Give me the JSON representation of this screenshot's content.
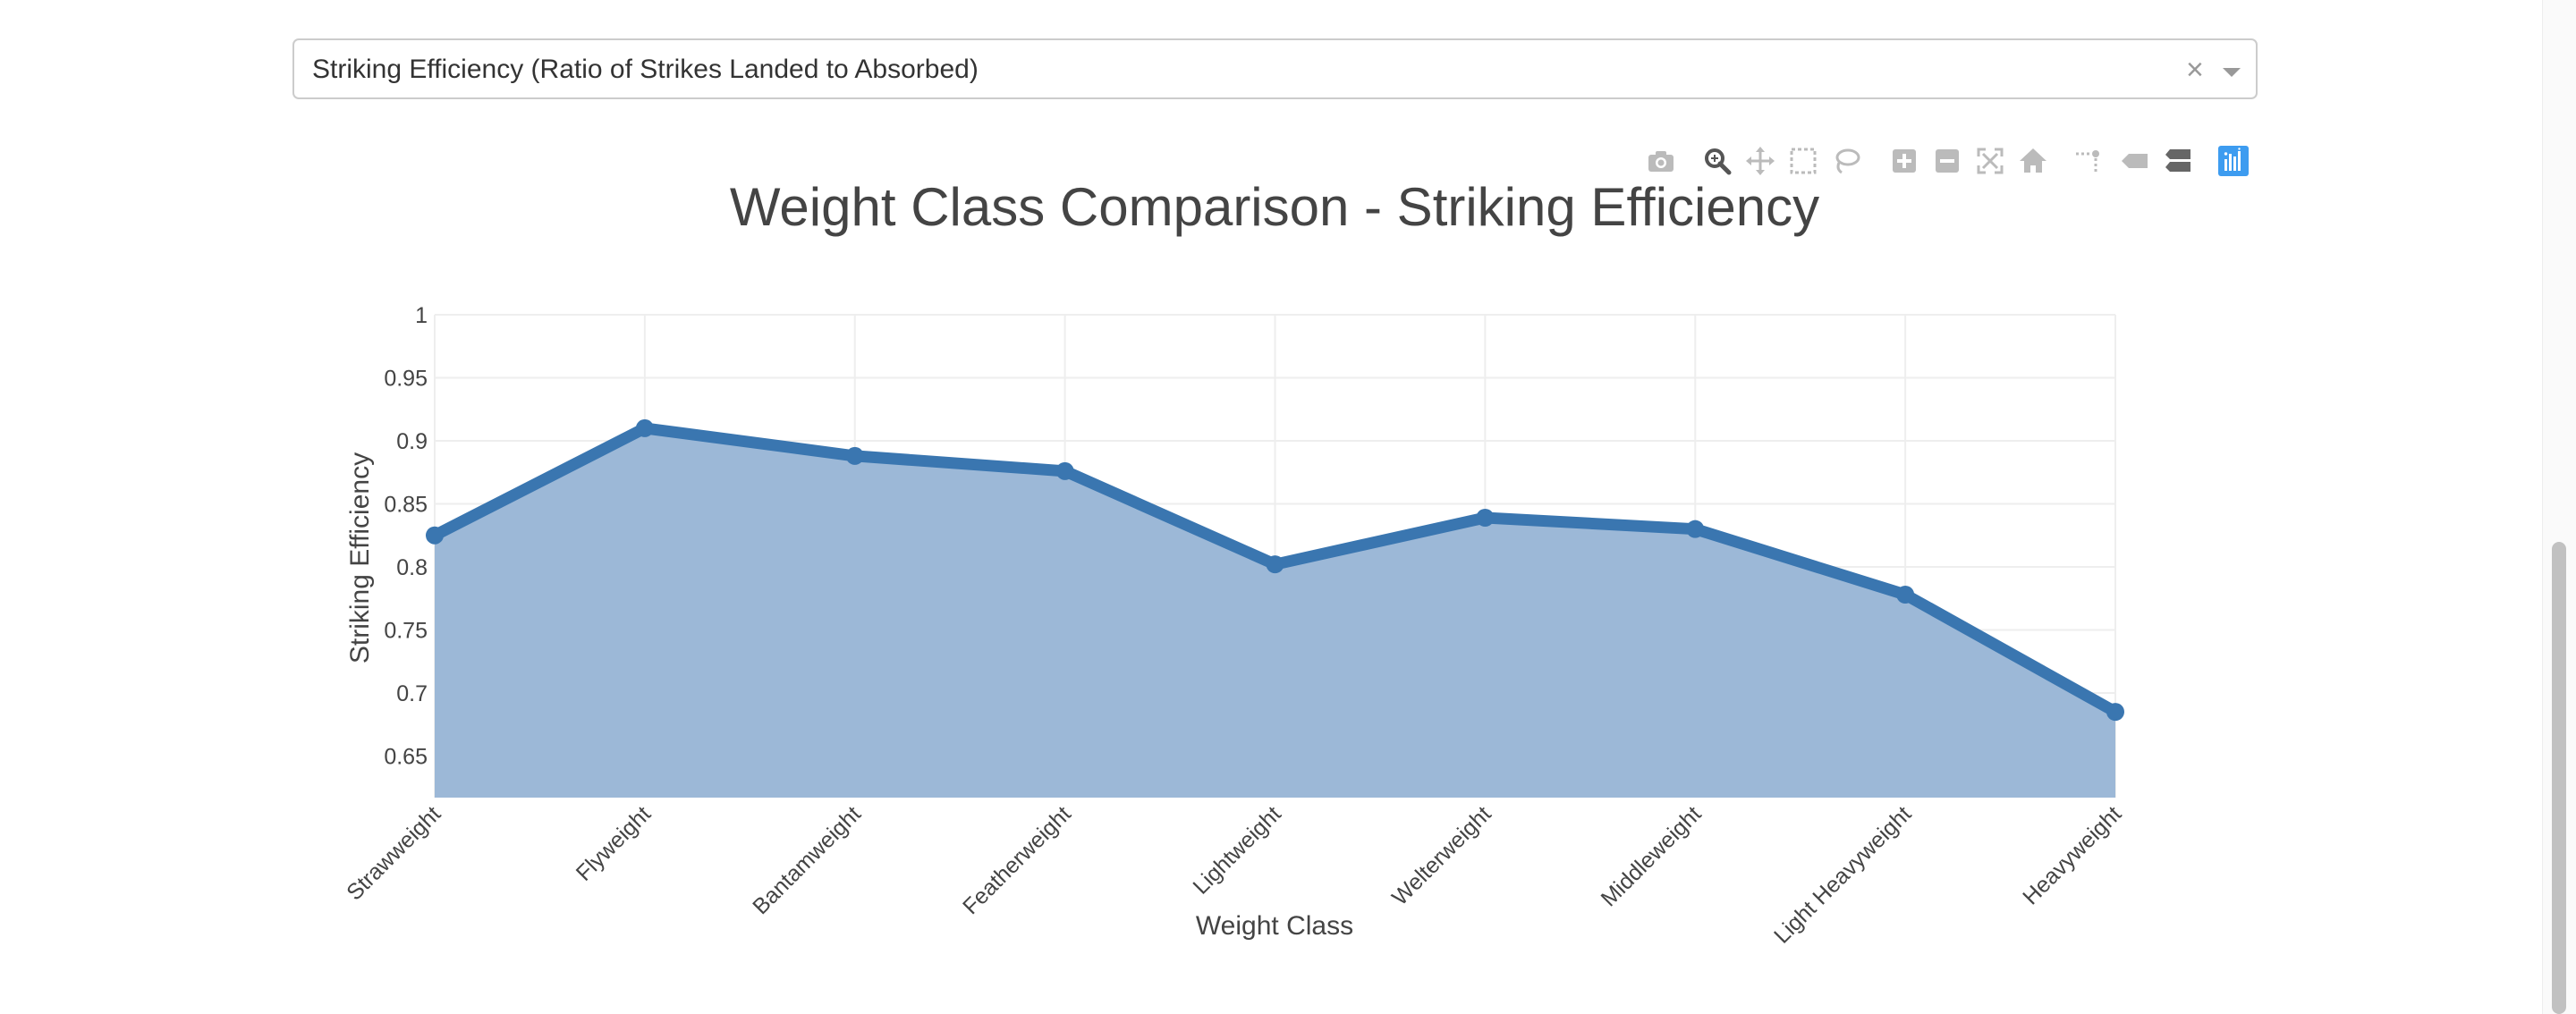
{
  "dropdown": {
    "selected": "Striking Efficiency (Ratio of Strikes Landed to Absorbed)",
    "clear_symbol": "×"
  },
  "modebar": {
    "icons": [
      "camera-icon",
      "zoom-icon",
      "pan-icon",
      "box-select-icon",
      "lasso-select-icon",
      "zoom-in-icon",
      "zoom-out-icon",
      "autoscale-icon",
      "reset-axes-icon",
      "spike-lines-icon",
      "hover-closest-icon",
      "hover-compare-icon",
      "plotly-logo-icon"
    ]
  },
  "colors": {
    "line": "#3a76b0",
    "fill": "#9cb8d7",
    "grid": "#eeeeee",
    "text": "#444444",
    "modebar_icon": "#bbbbbb",
    "modebar_active": "#555555",
    "plotly_blue": "#3d9cf0"
  },
  "chart_data": {
    "type": "area",
    "title": "Weight Class Comparison - Striking Efficiency",
    "xlabel": "Weight Class",
    "ylabel": "Striking Efficiency",
    "categories": [
      "Strawweight",
      "Flyweight",
      "Bantamweight",
      "Featherweight",
      "Lightweight",
      "Welterweight",
      "Middleweight",
      "Light Heavyweight",
      "Heavyweight"
    ],
    "values": [
      0.825,
      0.91,
      0.888,
      0.876,
      0.802,
      0.839,
      0.83,
      0.778,
      0.685
    ],
    "ylim": [
      0.617,
      1.0
    ],
    "yticks": [
      0.65,
      0.7,
      0.75,
      0.8,
      0.85,
      0.9,
      0.95,
      1
    ],
    "ytick_labels": [
      "0.65",
      "0.7",
      "0.75",
      "0.8",
      "0.85",
      "0.9",
      "0.95",
      "1"
    ],
    "grid": true,
    "legend": "none"
  }
}
